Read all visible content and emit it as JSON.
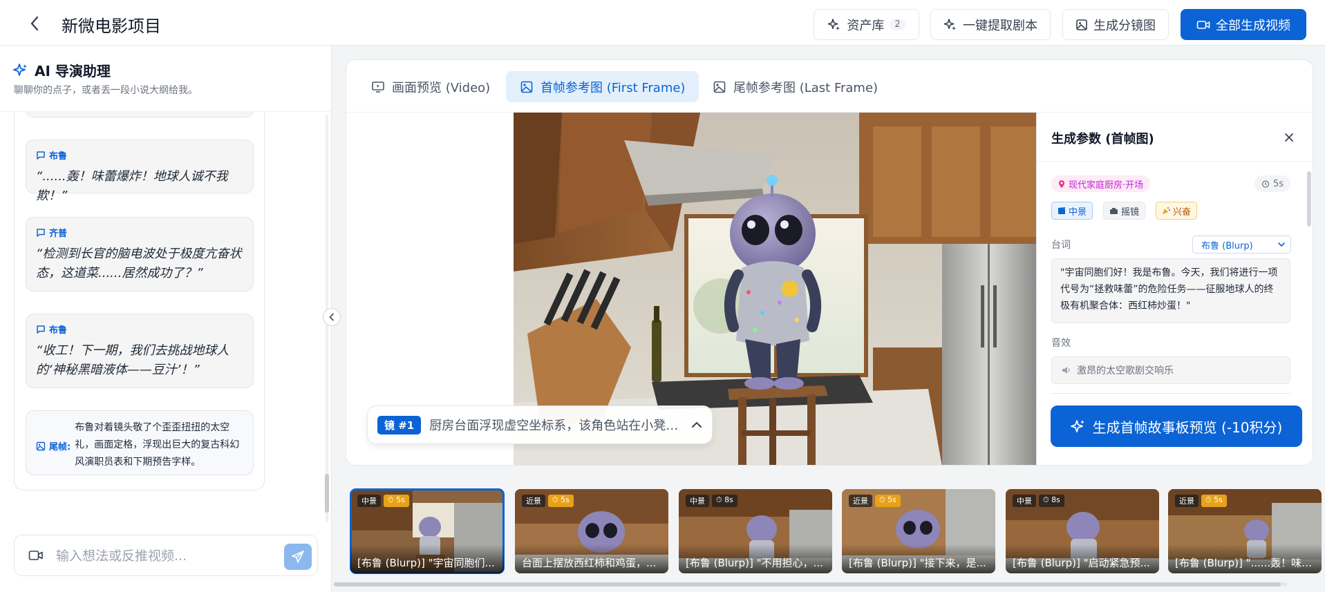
{
  "header": {
    "title": "新微电影项目",
    "assets_label": "资产库",
    "assets_count": "2",
    "extract_label": "一键提取剧本",
    "storyboard_label": "生成分镜图",
    "generate_all_label": "全部生成视频"
  },
  "sidebar": {
    "title": "AI 导演助理",
    "subtitle": "聊聊你的点子，或者丢一段小说大纲给我。",
    "messages": [
      {
        "speaker": "布鲁",
        "text": "“......轰！味蕾爆炸！地球人诚不我欺！”"
      },
      {
        "speaker": "齐普",
        "text": "“检测到长官的脑电波处于极度亢奋状态，这道菜......居然成功了？”"
      },
      {
        "speaker": "布鲁",
        "text": "“收工！下一期，我们去挑战地球人的‘神秘黑暗液体——豆汁’！”"
      }
    ],
    "last_frame": {
      "label": "尾帧:",
      "text": "布鲁对着镜头敬了个歪歪扭扭的太空礼，画面定格，浮现出巨大的复古科幻风演职员表和下期预告字样。"
    },
    "input_placeholder": "输入想法或反推视频..."
  },
  "tabs": [
    {
      "label": "画面预览 (Video)"
    },
    {
      "label": "首帧参考图 (First Frame)"
    },
    {
      "label": "尾帧参考图 (Last Frame)"
    }
  ],
  "caption": {
    "shot": "镜 #1",
    "text": "厨房台面浮现虚空坐标系，该角色站在小凳子..."
  },
  "params": {
    "title": "生成参数 (首帧图)",
    "location": "现代家庭厨房·开场",
    "duration": "5s",
    "shot_type": "中景",
    "camera_move": "摇镜",
    "mood": "兴奋",
    "dialogue_label": "台词",
    "speaker_select": "布鲁 (Blurp)",
    "dialogue": "\"宇宙同胞们好！我是布鲁。今天，我们将进行一项代号为“拯救味蕾”的危险任务——征服地球人的终极有机聚合体：西红柿炒蛋！\"",
    "sfx_label": "音效",
    "sfx": "激昂的太空歌剧交响乐",
    "generate_btn": "生成首帧故事板预览 (-10积分)"
  },
  "filmstrip": [
    {
      "shot": "中景",
      "dur": "5s",
      "caption": "[布鲁 (Blurp)] \"宇宙同胞们..."
    },
    {
      "shot": "近景",
      "dur": "5s",
      "caption": "台面上摆放西红柿和鸡蛋，..."
    },
    {
      "shot": "中景",
      "dur": "8s",
      "caption": "[布鲁 (Blurp)] \"不用担心，..."
    },
    {
      "shot": "近景",
      "dur": "5s",
      "caption": "[布鲁 (Blurp)] \"接下来，是..."
    },
    {
      "shot": "中景",
      "dur": "8s",
      "caption": "[布鲁 (Blurp)] \"启动紧急预..."
    },
    {
      "shot": "近景",
      "dur": "5s",
      "caption": "[布鲁 (Blurp)] \"......轰！味蕾..."
    }
  ],
  "colors": {
    "accent": "#0b63d6",
    "location_chip": "#c026d3",
    "mood_chip": "#b45309"
  }
}
